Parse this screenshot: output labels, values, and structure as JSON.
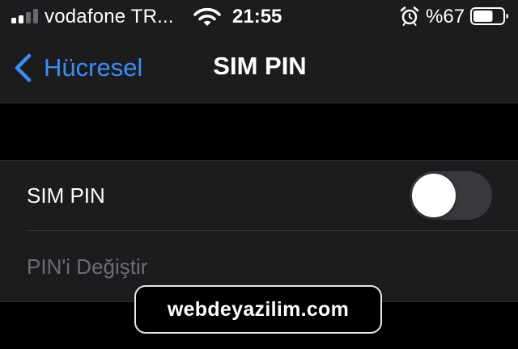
{
  "status_bar": {
    "signal_icon": "signal-bars-icon",
    "signal_level": 0.5,
    "carrier": "vodafone TR...",
    "wifi_icon": "wifi-icon",
    "time": "21:55",
    "alarm_icon": "alarm-clock-icon",
    "battery_percent": "%67",
    "battery_level": 0.67,
    "battery_icon": "battery-icon"
  },
  "nav": {
    "back_icon": "chevron-left-icon",
    "back_label": "Hücresel",
    "title": "SIM PIN"
  },
  "settings": {
    "sim_pin": {
      "label": "SIM PIN",
      "toggle_on": false
    },
    "change_pin": {
      "label": "PIN'i Değiştir",
      "enabled": false
    }
  },
  "watermark": "webdeyazilim.com",
  "colors": {
    "accent": "#3a8ef5",
    "background": "#000000",
    "grouped_cell": "#1c1c1e",
    "toggle_off": "#39393d",
    "disabled_text": "#6d6d72"
  }
}
